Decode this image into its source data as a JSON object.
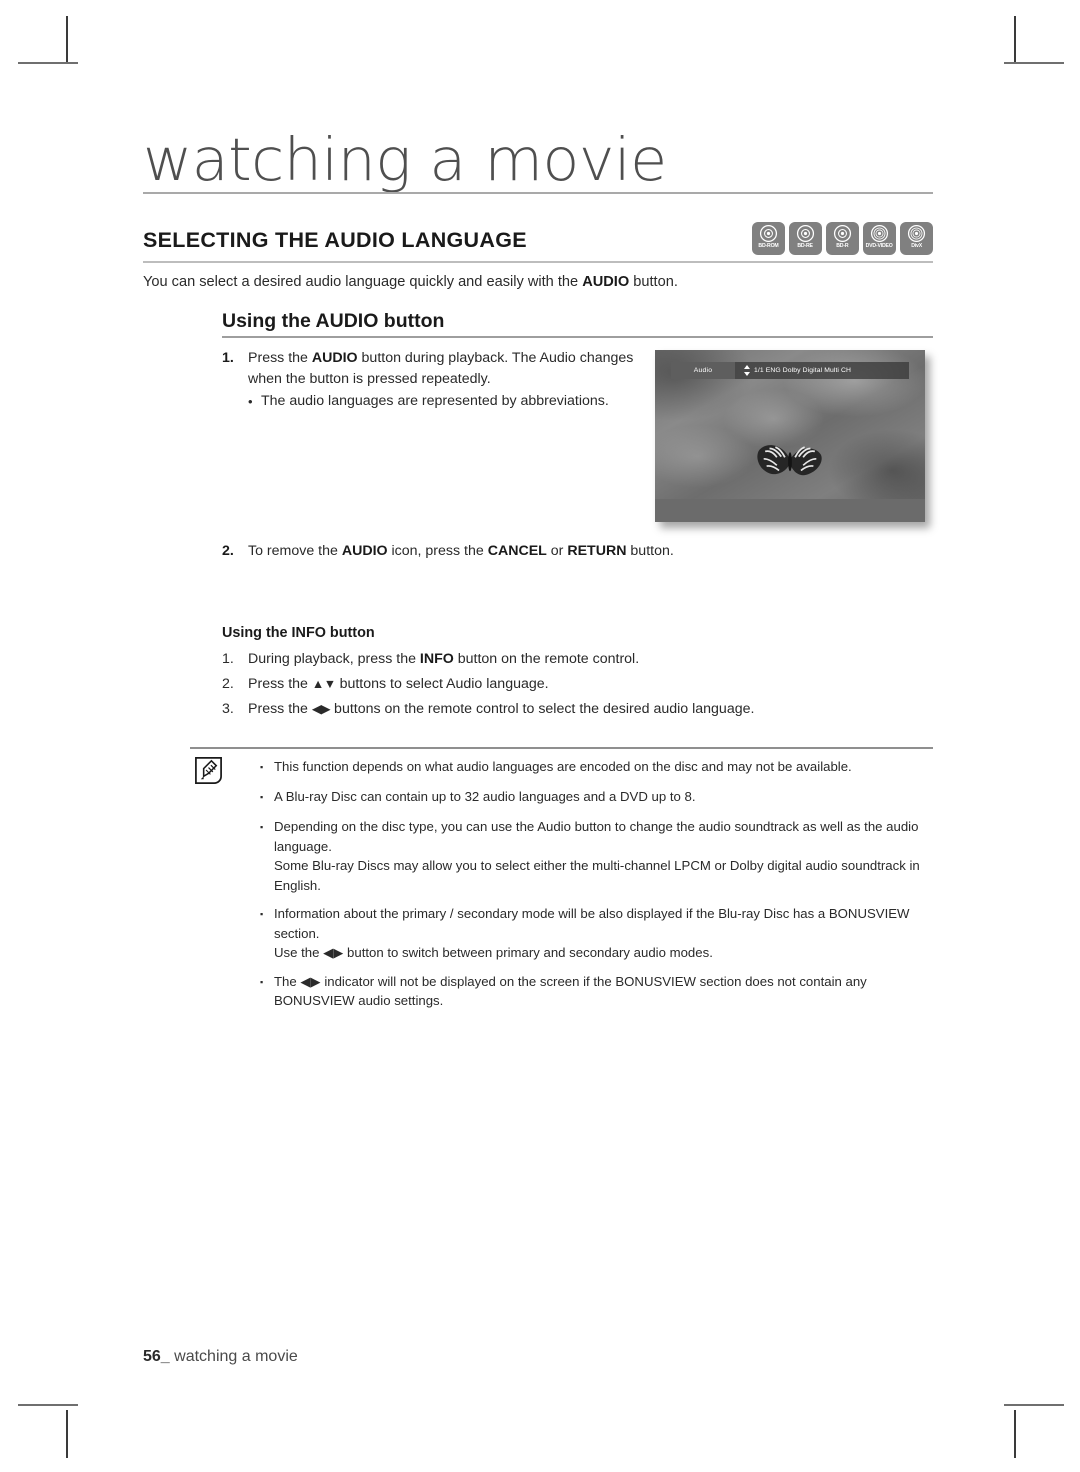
{
  "chapter": {
    "title": "watching a movie"
  },
  "section": {
    "heading": "SELECTING THE AUDIO LANGUAGE",
    "intro_prefix": "You can select a desired audio language quickly and easily with the ",
    "intro_bold": "AUDIO",
    "intro_suffix": " button."
  },
  "disc_badges": [
    {
      "label": "BD-ROM",
      "icon": "disc-icon"
    },
    {
      "label": "BD-RE",
      "icon": "disc-icon"
    },
    {
      "label": "BD-R",
      "icon": "disc-icon"
    },
    {
      "label": "DVD-VIDEO",
      "icon": "disc-icon"
    },
    {
      "label": "DivX",
      "icon": "divx-disc-icon"
    }
  ],
  "audio_button": {
    "heading": "Using the AUDIO button",
    "step1": {
      "num": "1.",
      "text_a": "Press the ",
      "bold_a": "AUDIO",
      "text_b": " button during playback. The Audio changes when the button is pressed repeatedly.",
      "bullet": "The audio languages are represented by abbreviations.",
      "bullet_dot": "•"
    },
    "step2": {
      "num": "2.",
      "text_a": "To remove the ",
      "bold_a": "AUDIO",
      "text_b": " icon, press the ",
      "bold_b": "CANCEL",
      "text_c": " or ",
      "bold_c": "RETURN",
      "text_d": " button."
    }
  },
  "tv_screenshot": {
    "osd_label": "Audio",
    "osd_arrows": "⬍",
    "osd_value": "1/1 ENG Dolby Digital Multi CH"
  },
  "info_button": {
    "heading": "Using the INFO button",
    "steps": [
      {
        "num": "1.",
        "text_a": "During playback, press the ",
        "bold_a": "INFO",
        "text_b": " button on the remote control."
      },
      {
        "num": "2.",
        "text_a": "Press the  ",
        "arrows": "▲▼",
        "text_b": " buttons to select Audio language."
      },
      {
        "num": "3.",
        "text_a": "Press the ",
        "arrows": "◀▶",
        "text_b": " buttons on the remote control to select the desired audio language."
      }
    ]
  },
  "notes": {
    "icon": "note-pencil-icon",
    "bullet": "▪",
    "items": [
      {
        "text": "This function depends on what audio languages are encoded on the disc and may not be available."
      },
      {
        "text": "A Blu-ray Disc can contain up to 32 audio languages and a DVD up to 8."
      },
      {
        "text": "Depending on the disc type, you can use the Audio button to change the audio soundtrack as well as the audio language.\nSome Blu-ray Discs may allow you to select either the multi-channel LPCM or Dolby digital audio soundtrack in English."
      },
      {
        "text": "Information about the primary / secondary mode will be also displayed if the Blu-ray Disc has a BONUSVIEW section.\nUse the ◀▶ button to switch between primary and secondary audio modes."
      },
      {
        "text": "The ◀▶ indicator will not be displayed on the screen if the BONUSVIEW section does not contain any BONUSVIEW audio settings."
      }
    ]
  },
  "footer": {
    "page_number": "56_",
    "label": " watching a movie"
  }
}
